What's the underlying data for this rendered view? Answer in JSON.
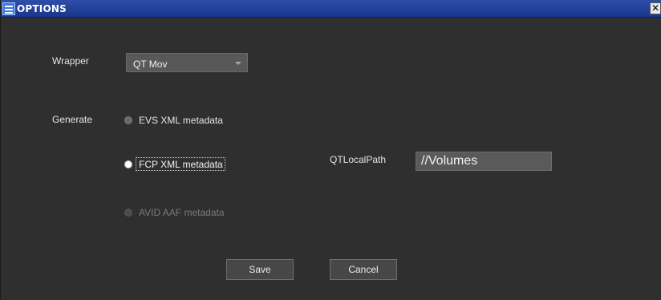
{
  "window": {
    "title": "OPTIONS",
    "close_glyph": "✕"
  },
  "wrapper": {
    "label": "Wrapper",
    "selected": "QT Mov"
  },
  "generate": {
    "label": "Generate",
    "options": [
      {
        "label": "EVS XML metadata",
        "selected": false,
        "enabled": true
      },
      {
        "label": "FCP XML metadata",
        "selected": true,
        "enabled": true
      },
      {
        "label": "AVID AAF metadata",
        "selected": false,
        "enabled": false
      }
    ]
  },
  "qt_local_path": {
    "label": "QTLocalPath",
    "value": "//Volumes"
  },
  "buttons": {
    "save": "Save",
    "cancel": "Cancel"
  },
  "icons": {
    "menu": "menu-icon",
    "close": "close-icon",
    "dropdown": "chevron-down-icon"
  },
  "colors": {
    "background": "#2f2f2f",
    "titlebar": "#19368f",
    "field": "#585858"
  }
}
